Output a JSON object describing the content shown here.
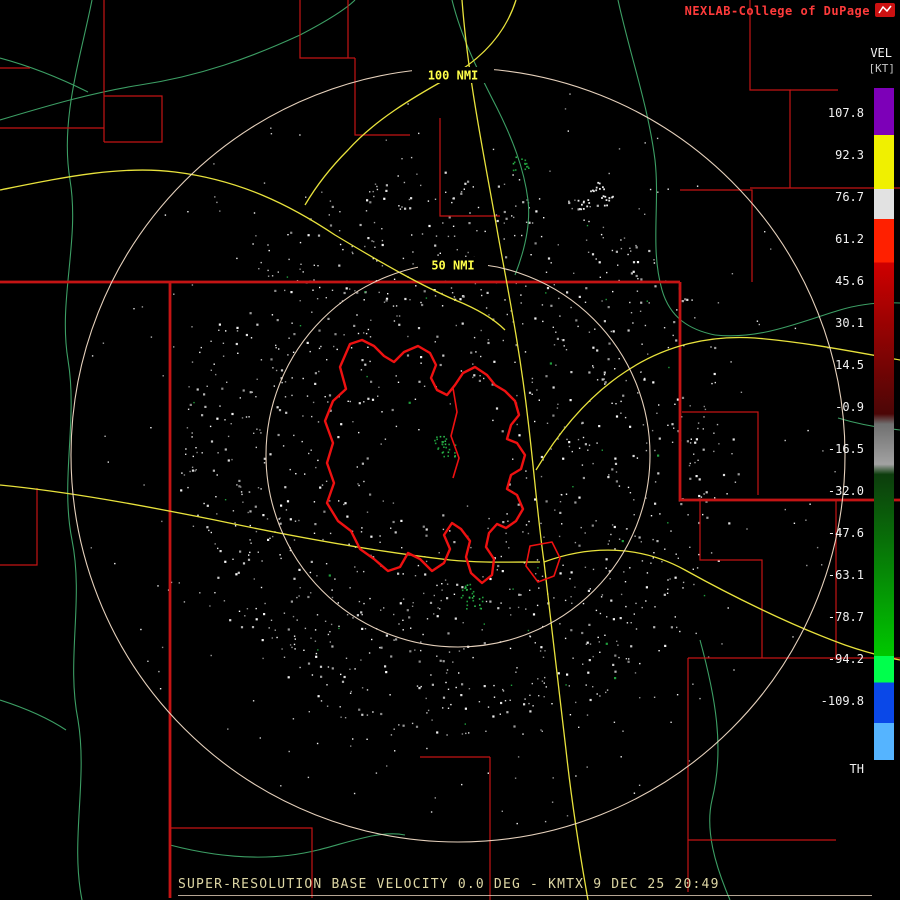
{
  "brand": {
    "text": "NEXLAB-College of DuPage"
  },
  "legend": {
    "title": "VEL",
    "units": "[KT]",
    "threshold_label": "TH",
    "ticks": [
      "107.8",
      "92.3",
      "76.7",
      "61.2",
      "45.6",
      "30.1",
      "14.5",
      "-0.9",
      "-16.5",
      "-32.0",
      "-47.6",
      "-63.1",
      "-78.7",
      "-94.2",
      "-109.8"
    ]
  },
  "rings": {
    "outer_label": "100 NMI",
    "inner_label": "50 NMI"
  },
  "caption": {
    "text": "SUPER-RESOLUTION BASE VELOCITY 0.0 DEG - KMTX 9 DEC 25 20:49"
  },
  "colors": {
    "brand-red": "#ff3b3b",
    "map-border-red": "#c41414",
    "lake-red": "#ee1111",
    "highway-yellow": "#e8e23c",
    "river-green": "#3c9e64",
    "ring-tan": "#f2dcc6",
    "label-yellow": "#ffff4a",
    "caption-tan": "#ddd6a4",
    "legend-text": "#f2f2f2"
  }
}
